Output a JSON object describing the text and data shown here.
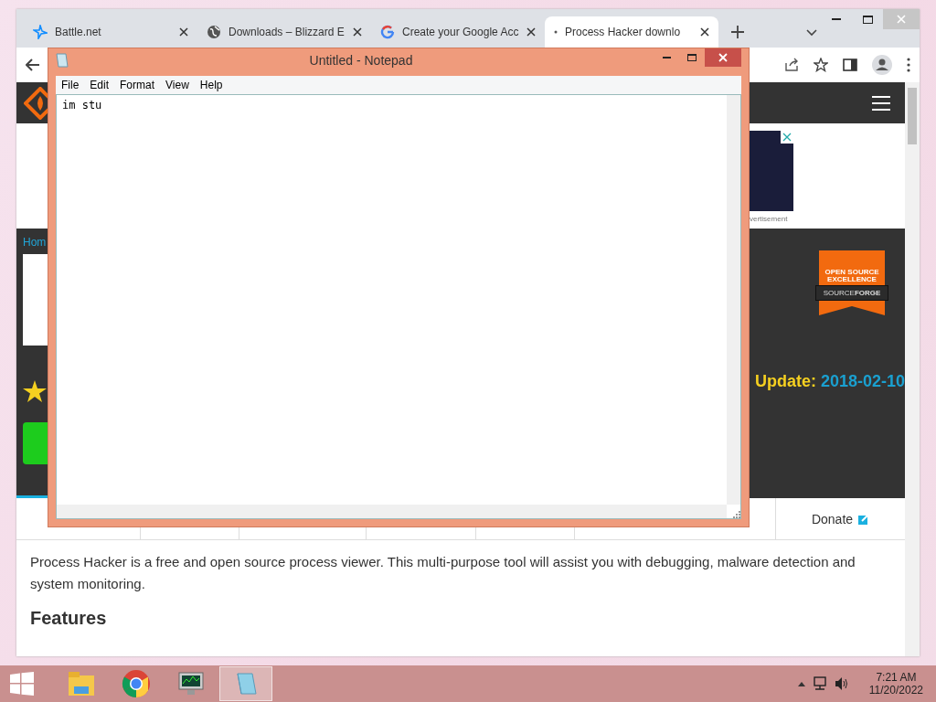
{
  "browser": {
    "tabs": [
      {
        "title": "Battle.net",
        "selected": false,
        "kind": "battlenet"
      },
      {
        "title": "Downloads – Blizzard E",
        "selected": false,
        "kind": "globe"
      },
      {
        "title": "Create your Google Acc",
        "selected": false,
        "kind": "google"
      },
      {
        "title": "Process Hacker downlo",
        "selected": true,
        "kind": "dot"
      }
    ]
  },
  "site": {
    "breadcrumb": "Hom",
    "ad_label": "vertisement",
    "badge": {
      "title": "OPEN SOURCE EXCELLENCE",
      "brand": "SOURCE**FORGE**"
    },
    "update_label": "Update:",
    "update_date": "2018-02-10",
    "nav_last": "Donate",
    "description": "Process Hacker is a free and open source process viewer. This multi-purpose tool will assist you with debugging, malware detection and system monitoring.",
    "features_heading": "Features"
  },
  "notepad": {
    "title": "Untitled - Notepad",
    "menu": [
      "File",
      "Edit",
      "Format",
      "View",
      "Help"
    ],
    "text": "im stu"
  },
  "taskbar": {
    "apps": [
      {
        "kind": "explorer",
        "selected": false
      },
      {
        "kind": "chrome",
        "selected": false
      },
      {
        "kind": "monitor",
        "selected": false
      },
      {
        "kind": "notepad",
        "selected": true
      }
    ],
    "time": "7:21 AM",
    "date": "11/20/2022"
  }
}
